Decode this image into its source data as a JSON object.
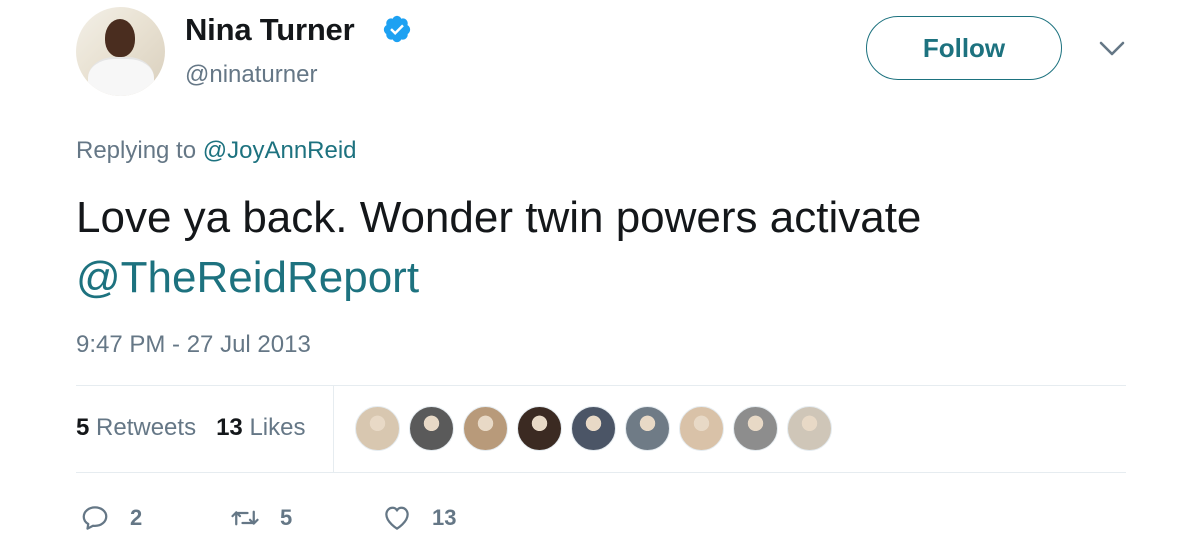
{
  "author": {
    "name": "Nina Turner",
    "handle": "@ninaturner",
    "verified": true
  },
  "header": {
    "follow_label": "Follow"
  },
  "reply": {
    "prefix": "Replying to",
    "to": "@JoyAnnReid"
  },
  "tweet": {
    "text": "Love ya back. Wonder twin powers activate",
    "mention": "@TheReidReport",
    "timestamp": "9:47 PM - 27 Jul 2013"
  },
  "stats": {
    "retweets_count": "5",
    "retweets_label": "Retweets",
    "likes_count": "13",
    "likes_label": "Likes"
  },
  "likers": [
    {
      "icon": "red-wings-logo-avatar",
      "color": "#d8c7b0"
    },
    {
      "icon": "bearded-man-avatar",
      "color": "#5a5a5a"
    },
    {
      "icon": "dog-avatar",
      "color": "#b89a7a"
    },
    {
      "icon": "couple-avatar",
      "color": "#3b2a22"
    },
    {
      "icon": "older-man-avatar",
      "color": "#4b5566"
    },
    {
      "icon": "woman-hat-avatar",
      "color": "#6f7b86"
    },
    {
      "icon": "blonde-woman-avatar",
      "color": "#d9c2a8"
    },
    {
      "icon": "woman-bw-avatar",
      "color": "#8d8d8d"
    },
    {
      "icon": "woman-dark-hair-avatar",
      "color": "#cfc6b8"
    }
  ],
  "actions": {
    "replies": "2",
    "retweets": "5",
    "likes": "13"
  },
  "colors": {
    "accent": "#1d727f",
    "verified": "#1da1f2",
    "muted": "#657786",
    "text": "#14171a"
  }
}
